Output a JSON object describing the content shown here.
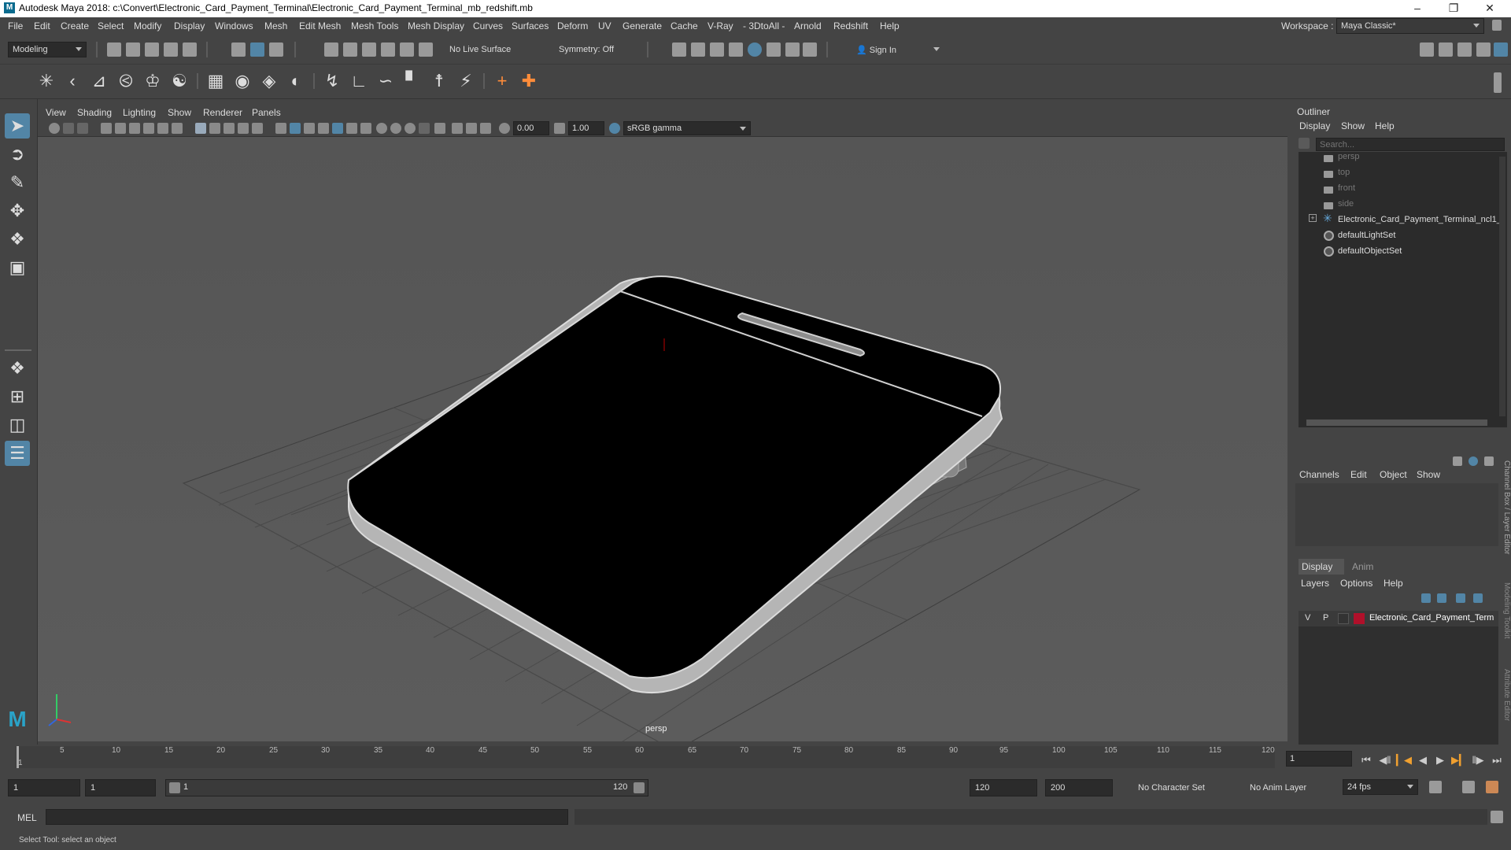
{
  "title_bar": {
    "logo": "M",
    "title": "Autodesk Maya 2018: c:\\Convert\\Electronic_Card_Payment_Terminal\\Electronic_Card_Payment_Terminal_mb_redshift.mb",
    "minimize": "–",
    "maximize": "❐",
    "close": "✕"
  },
  "menu": [
    "File",
    "Edit",
    "Create",
    "Select",
    "Modify",
    "Display",
    "Windows",
    "Mesh",
    "Edit Mesh",
    "Mesh Tools",
    "Mesh Display",
    "Curves",
    "Surfaces",
    "Deform",
    "UV",
    "Generate",
    "Cache",
    "V-Ray",
    "- 3DtoAll -",
    "Arnold",
    "Redshift",
    "Help"
  ],
  "workspace": {
    "label": "Workspace :",
    "value": "Maya Classic*"
  },
  "status_line": {
    "mode": "Modeling",
    "live_surface": "No Live Surface",
    "symmetry": "Symmetry: Off",
    "sign_in": "Sign In"
  },
  "viewport_menu": [
    "View",
    "Shading",
    "Lighting",
    "Show",
    "Renderer",
    "Panels"
  ],
  "viewport_toolbar": {
    "exposure": "0.00",
    "gamma": "1.00",
    "color_space": "sRGB gamma"
  },
  "viewport": {
    "camera_label": "persp"
  },
  "outliner": {
    "title": "Outliner",
    "menu": [
      "Display",
      "Show",
      "Help"
    ],
    "search_placeholder": "Search...",
    "items": [
      {
        "label": "persp",
        "icon": "camera-icon",
        "dim": true
      },
      {
        "label": "top",
        "icon": "camera-icon",
        "dim": true
      },
      {
        "label": "front",
        "icon": "camera-icon",
        "dim": true
      },
      {
        "label": "side",
        "icon": "camera-icon",
        "dim": true
      },
      {
        "label": "Electronic_Card_Payment_Terminal_ncl1_",
        "icon": "joint-icon",
        "dim": false
      },
      {
        "label": "defaultLightSet",
        "icon": "set-icon",
        "dim": false
      },
      {
        "label": "defaultObjectSet",
        "icon": "set-icon",
        "dim": false
      }
    ]
  },
  "channel_box": {
    "menu": [
      "Channels",
      "Edit",
      "Object",
      "Show"
    ]
  },
  "layer_editor": {
    "tabs": [
      "Display",
      "Anim"
    ],
    "menu": [
      "Layers",
      "Options",
      "Help"
    ],
    "layer": {
      "v": "V",
      "p": "P",
      "name": "Electronic_Card_Payment_Term",
      "color": "#b0102a"
    }
  },
  "side_tabs": [
    "Channel Box / Layer Editor",
    "Modeling Toolkit",
    "Attribute Editor"
  ],
  "timeline": {
    "ticks": [
      "5",
      "10",
      "15",
      "20",
      "25",
      "30",
      "35",
      "40",
      "45",
      "50",
      "55",
      "60",
      "65",
      "70",
      "75",
      "80",
      "85",
      "90",
      "95",
      "100",
      "105",
      "110",
      "115",
      "120"
    ],
    "current_marker": "1",
    "current_frame": "1"
  },
  "range": {
    "start": "1",
    "playback_start": "1",
    "slider_start": "1",
    "slider_end": "120",
    "playback_end": "120",
    "end": "200",
    "character_set": "No Character Set",
    "anim_layer": "No Anim Layer",
    "fps": "24 fps"
  },
  "command_line": {
    "label": "MEL"
  },
  "status": {
    "help_text": "Select Tool: select an object"
  },
  "colors": {
    "accent": "#5285a6",
    "layer_color": "#b0102a",
    "ui_bg": "#444444",
    "field_bg": "#2b2b2b"
  }
}
